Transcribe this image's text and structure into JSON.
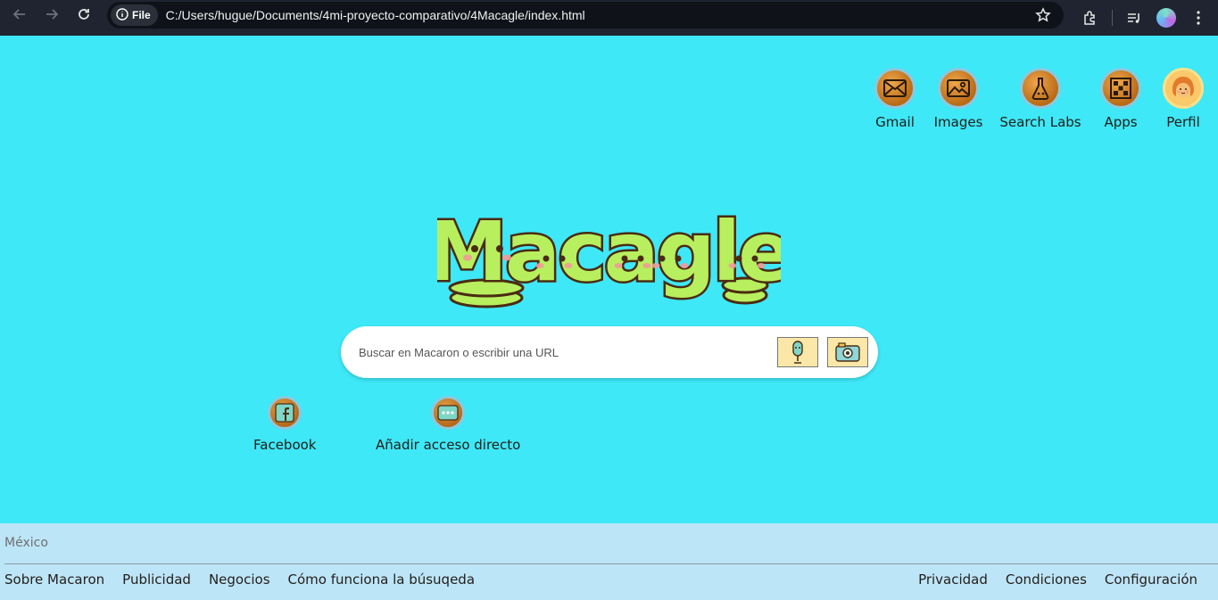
{
  "browser": {
    "site_chip_label": "File",
    "url": "C:/Users/hugue/Documents/4mi-proyecto-comparativo/4Macagle/index.html"
  },
  "topnav": {
    "items": [
      {
        "label": "Gmail",
        "icon": "mail-icon"
      },
      {
        "label": "Images",
        "icon": "image-icon"
      },
      {
        "label": "Search Labs",
        "icon": "flask-icon"
      },
      {
        "label": "Apps",
        "icon": "apps-grid-icon"
      },
      {
        "label": "Perfil",
        "icon": "avatar"
      }
    ]
  },
  "logo": {
    "text": "Macagle",
    "color": "#b8ef5e",
    "outline": "#4a2b12"
  },
  "search": {
    "placeholder": "Buscar en Macaron o escribir una URL"
  },
  "shortcuts": [
    {
      "label": "Facebook",
      "icon": "facebook-icon"
    },
    {
      "label": "Añadir acceso directo",
      "icon": "add-shortcut-icon"
    }
  ],
  "footer": {
    "country": "México",
    "left_links": [
      "Sobre Macaron",
      "Publicidad",
      "Negocios",
      "Cómo funciona la búsuqeda"
    ],
    "right_links": [
      "Privacidad",
      "Condiciones",
      "Configuración"
    ]
  },
  "colors": {
    "page_bg": "#3ee8f7",
    "footer_bg": "#bde5f8",
    "chrome_bg": "#1f2430"
  }
}
